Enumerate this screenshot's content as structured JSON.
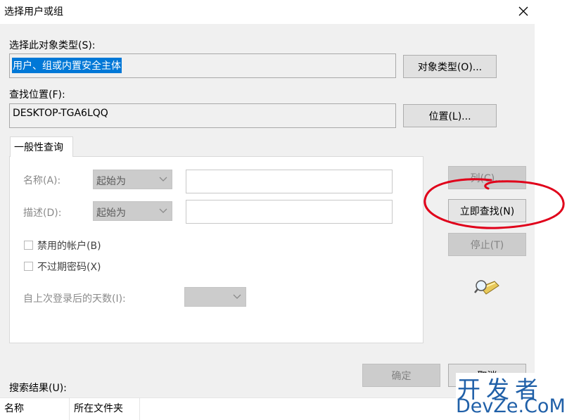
{
  "window": {
    "title": "选择用户或组"
  },
  "object_type": {
    "label": "选择此对象类型(S):",
    "value": "用户、组或内置安全主体",
    "button": "对象类型(O)..."
  },
  "location": {
    "label": "查找位置(F):",
    "value": "DESKTOP-TGA6LQQ",
    "button": "位置(L)..."
  },
  "tab": {
    "label": "一般性查询"
  },
  "query": {
    "name_label": "名称(A):",
    "name_mode": "起始为",
    "desc_label": "描述(D):",
    "desc_mode": "起始为",
    "disabled_accounts": "禁用的帐户(B)",
    "no_expire_password": "不过期密码(X)",
    "days_label": "自上次登录后的天数(I):"
  },
  "buttons": {
    "columns": "列(C)...",
    "find_now": "立即查找(N)",
    "stop": "停止(T)",
    "ok": "确定",
    "cancel": "取消"
  },
  "results": {
    "label": "搜索结果(U):",
    "columns": [
      "名称",
      "所在文件夹"
    ]
  },
  "watermark": {
    "line1": "开发者",
    "line2": "DevZe.CoM"
  },
  "colors": {
    "annotation": "#e0001a",
    "selection": "#0078d7"
  }
}
